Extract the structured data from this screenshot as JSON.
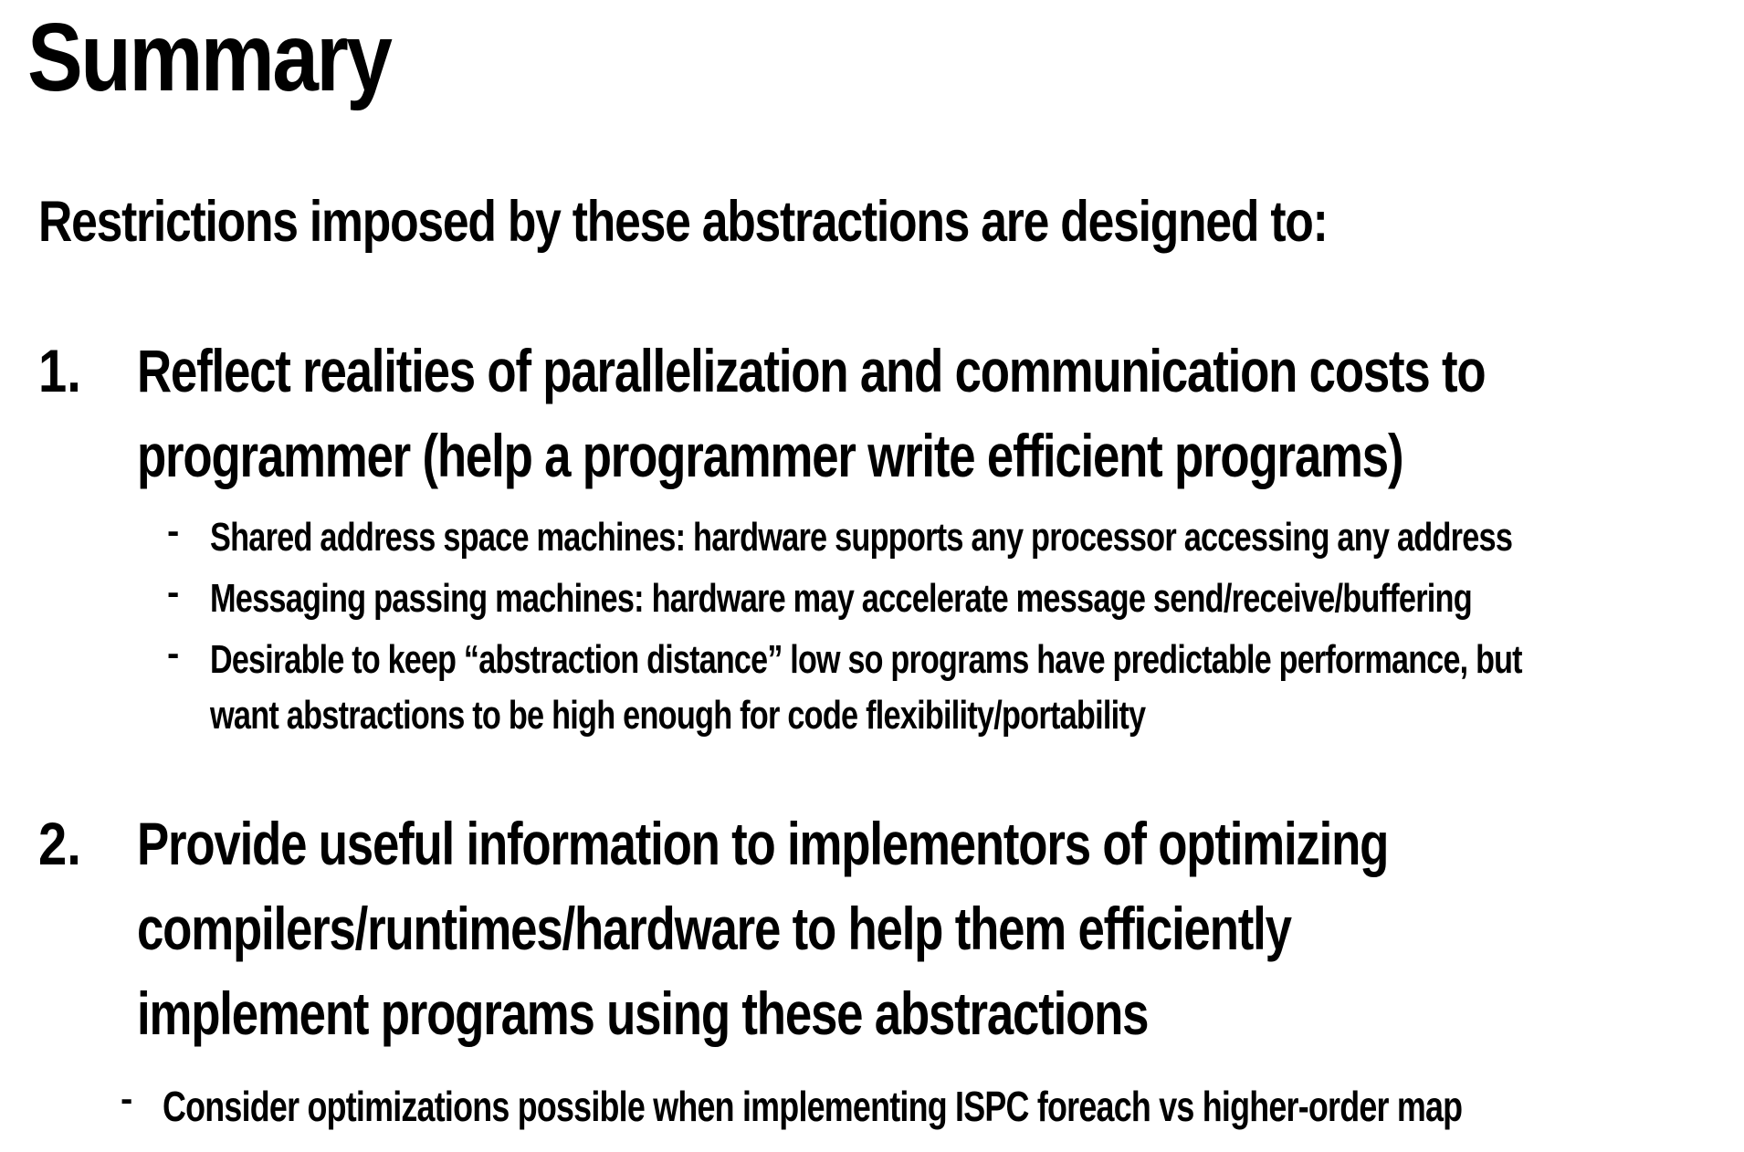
{
  "title": "Summary",
  "intro": "Restrictions imposed by these abstractions are designed to:",
  "items": [
    {
      "number": "1.",
      "lines": [
        "Reflect realities of parallelization and communication costs to",
        "programmer (help a programmer write efficient programs)"
      ],
      "bullet": "-",
      "subpoints": [
        {
          "lines": [
            "Shared address space machines: hardware supports any processor accessing any address"
          ]
        },
        {
          "lines": [
            "Messaging passing machines: hardware may accelerate message send/receive/buffering"
          ]
        },
        {
          "lines": [
            "Desirable to keep “abstraction distance” low so programs have predictable performance, but",
            "want abstractions to be high enough for code flexibility/portability"
          ]
        }
      ]
    },
    {
      "number": "2.",
      "lines": [
        "Provide useful information to implementors of optimizing",
        "compilers/runtimes/hardware to help them efficiently",
        "implement programs using these abstractions"
      ],
      "bullet": "-",
      "subpoints": [
        {
          "lines": [
            "Consider optimizations possible when implementing ISPC foreach vs higher-order map"
          ]
        }
      ]
    }
  ]
}
